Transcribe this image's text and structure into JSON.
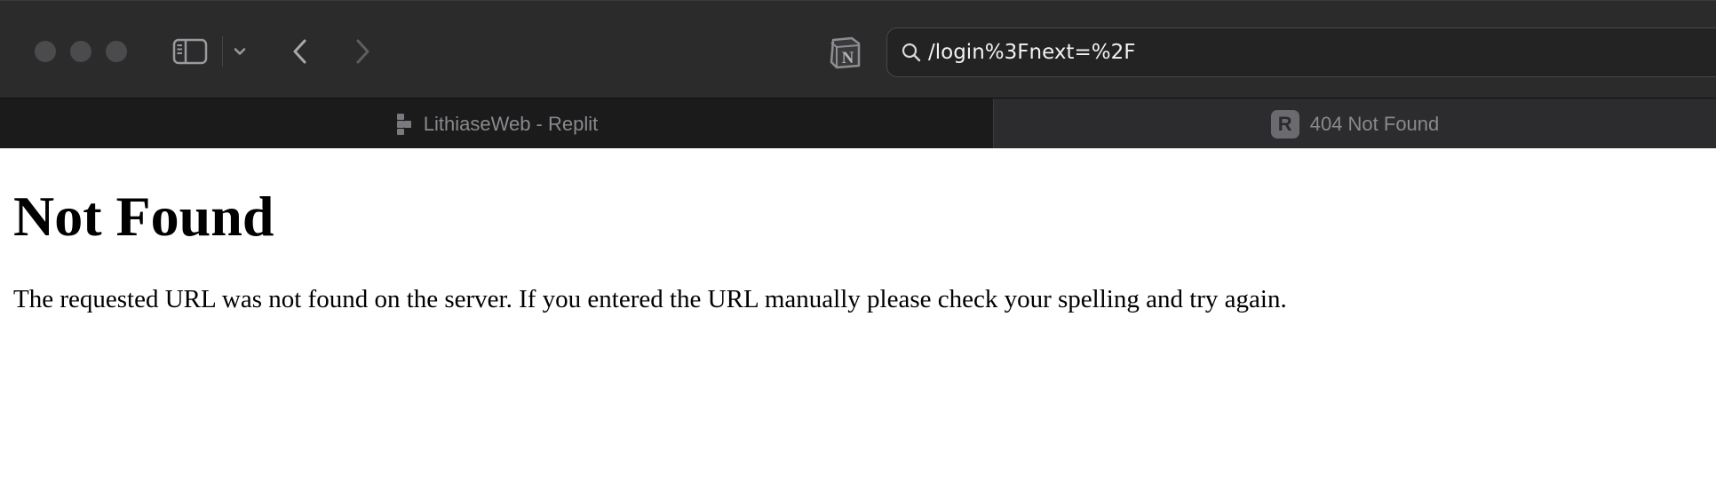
{
  "toolbar": {
    "address_value": "/login%3Fnext=%2F"
  },
  "tabs": [
    {
      "label": "LithiaseWeb - Replit",
      "icon": "replit-icon",
      "active": false
    },
    {
      "label": "404 Not Found",
      "icon_letter": "R",
      "active": true
    }
  ],
  "page": {
    "heading": "Not Found",
    "message": "The requested URL was not found on the server. If you entered the URL manually please check your spelling and try again."
  },
  "colors": {
    "chrome_bg": "#2b2b2c",
    "tabbar_bg": "#1c1c1d",
    "active_tab_bg": "#2c2c2e",
    "traffic_light": "#4b4b4d",
    "address_text": "#f2f2f4"
  },
  "icons": {
    "sidebar": "sidebar-toggle-icon",
    "chevron": "chevron-down-icon",
    "back": "back-arrow-icon",
    "forward": "forward-arrow-icon",
    "notion": "notion-icon",
    "search": "search-icon"
  }
}
